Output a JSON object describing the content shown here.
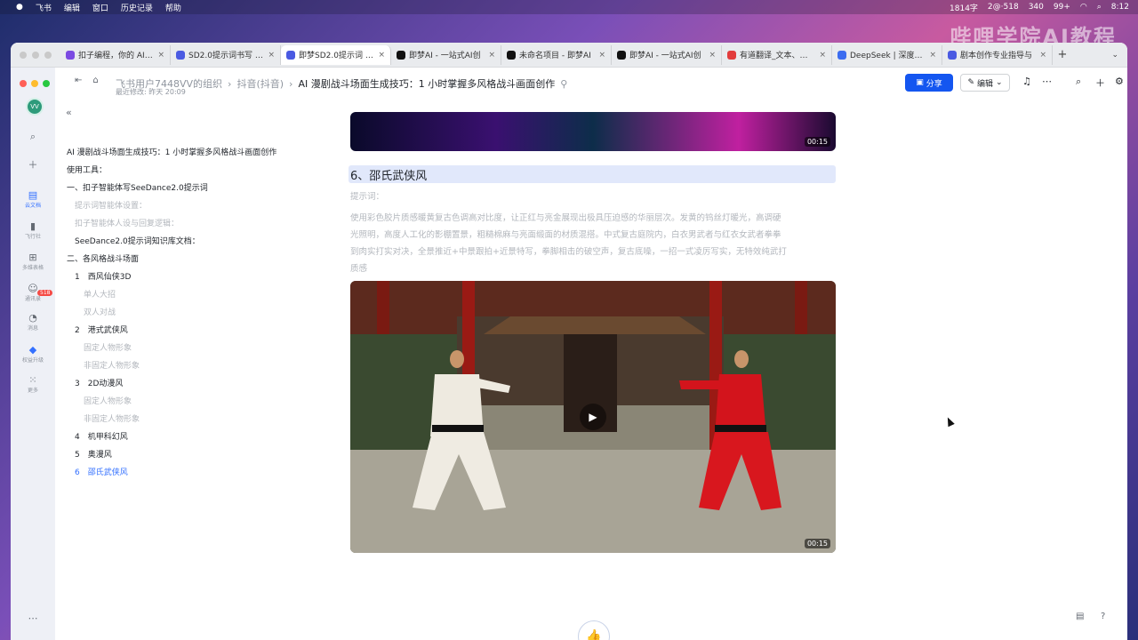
{
  "menubar": {
    "apple": "",
    "items": [
      "飞书",
      "编辑",
      "窗口",
      "历史记录",
      "帮助"
    ],
    "status": [
      "1814字",
      "2@·518",
      "340",
      "99+",
      "8:12"
    ]
  },
  "watermark": "哔哩学院AI教程",
  "browser_tabs": [
    {
      "label": "扣子编程，你的 AI 开",
      "icon_color": "#7b4ae2"
    },
    {
      "label": "SD2.0提示词书写 - 飞",
      "icon_color": "#4a5ae2"
    },
    {
      "label": "即梦SD2.0提示词 - 飞",
      "icon_color": "#4a5ae2"
    },
    {
      "label": "即梦AI - 一站式AI创",
      "icon_color": "#111"
    },
    {
      "label": "未命名项目 - 即梦AI",
      "icon_color": "#111"
    },
    {
      "label": "即梦AI - 一站式AI创",
      "icon_color": "#111"
    },
    {
      "label": "有道翻译_文本、文档",
      "icon_color": "#e23c3c"
    },
    {
      "label": "DeepSeek | 深度求索",
      "icon_color": "#3b6cf0"
    },
    {
      "label": "剧本创作专业指导与",
      "icon_color": "#4a5ae2"
    }
  ],
  "rail": {
    "avatar": "VV",
    "items": [
      "云文档",
      "飞行社",
      "多维表格",
      "通讯录",
      "消息",
      "权益升级",
      "更多"
    ],
    "badge": "518"
  },
  "topbar": {
    "crumbs": [
      "飞书用户7448VV的组织",
      "抖音(抖音)",
      "AI 漫剧战斗场面生成技巧：1 小时掌握多风格战斗画面创作"
    ],
    "sub": "最近修改: 昨天 20:09",
    "share": "分享",
    "edit": "编辑"
  },
  "outline": [
    {
      "text": "AI 漫剧战斗场面生成技巧：1 小时掌握多风格战斗画面创作",
      "level": "h"
    },
    {
      "text": "使用工具：",
      "level": "h"
    },
    {
      "text": "一、扣子智能体写SeeDance2.0提示词",
      "level": "h"
    },
    {
      "text": "提示词智能体设置：",
      "level": "m"
    },
    {
      "text": "扣子智能体人设与回复逻辑：",
      "level": "m"
    },
    {
      "text": "SeeDance2.0提示词知识库文档：",
      "level": "mh"
    },
    {
      "text": "二、各风格战斗场面",
      "level": "h"
    },
    {
      "text": "1　西风仙侠3D",
      "level": "n"
    },
    {
      "text": "单人大招",
      "level": "m"
    },
    {
      "text": "双人对战",
      "level": "m"
    },
    {
      "text": "2　港式武侠风",
      "level": "n"
    },
    {
      "text": "固定人物形象",
      "level": "m"
    },
    {
      "text": "非固定人物形象",
      "level": "m"
    },
    {
      "text": "3　2D动漫风",
      "level": "n"
    },
    {
      "text": "固定人物形象",
      "level": "m"
    },
    {
      "text": "非固定人物形象",
      "level": "m"
    },
    {
      "text": "4　机甲科幻风",
      "level": "n"
    },
    {
      "text": "5　奥漫风",
      "level": "n"
    },
    {
      "text": "6　邵氏武侠风",
      "level": "active"
    }
  ],
  "doc": {
    "top_video_time": "00:15",
    "heading": "6、邵氏武侠风",
    "prompt_label": "提示词：",
    "prompt_lines": [
      "使用彩色胶片质感暖黄复古色调高对比度，让正红与亮金展现出极具压迫感的华丽层次。发黄的钨丝灯暖光，高调硬",
      "光照明，高度人工化的影棚置景，粗糙棉麻与亮面缎面的材质混搭。中式复古庭院内，白衣男武者与红衣女武者拳拳",
      "到肉实打实对决，全景推近+中景跟拍+近景特写，拳脚相击的破空声，复古底噪，一招一式凌厉写实，无特效纯武打",
      "质感"
    ],
    "main_video_time": "00:15"
  }
}
